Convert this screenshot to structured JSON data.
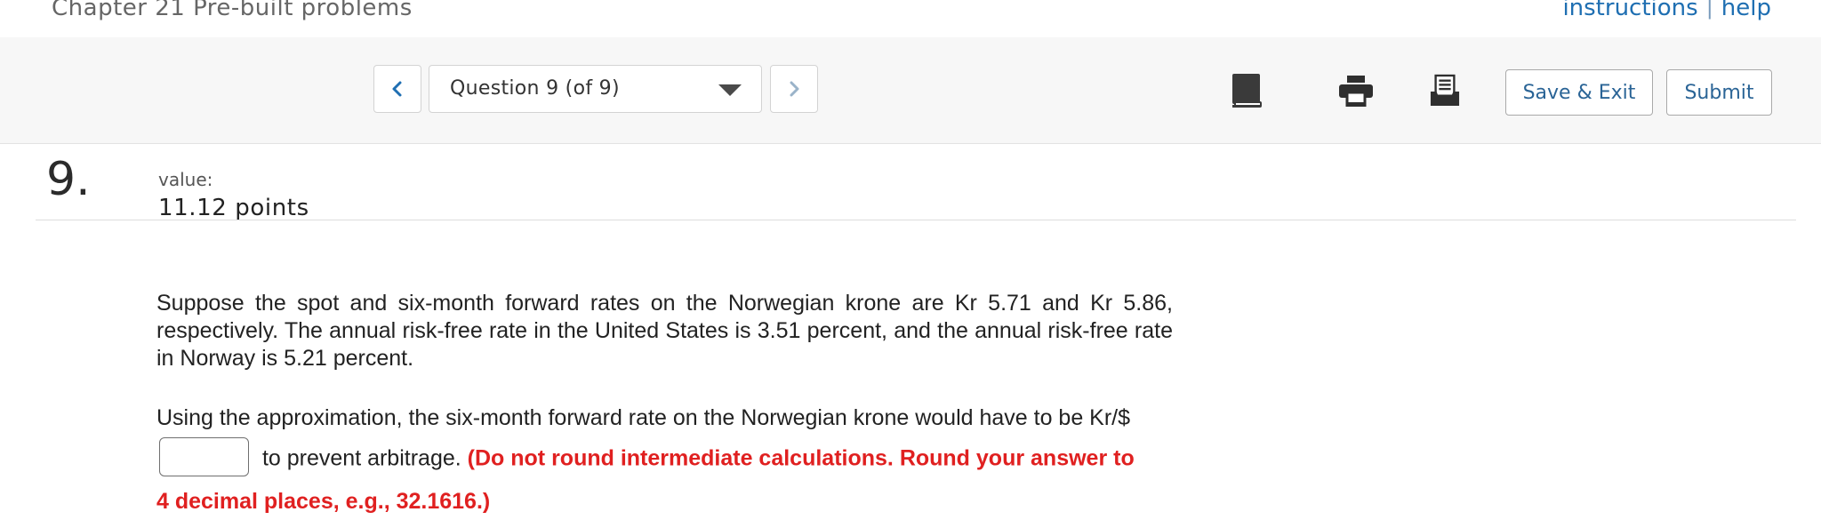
{
  "header": {
    "chapter_title": "Chapter 21 Pre-built problems",
    "instructions_link": "instructions",
    "help_link": "help",
    "link_separator": "|"
  },
  "toolbar": {
    "question_selector": "Question 9 (of 9)",
    "save_exit_label": "Save & Exit",
    "submit_label": "Submit",
    "icons": [
      "chevron-left-icon",
      "chevron-down-icon",
      "chevron-right-icon",
      "book-icon",
      "print-icon",
      "list-icon"
    ]
  },
  "question": {
    "number": "9.",
    "value_label": "value:",
    "value_points": "11.12 points",
    "paragraph1": "Suppose the spot and six-month forward rates on the Norwegian krone are Kr 5.71 and Kr 5.86, respectively. The annual risk-free rate in the United States is 3.51 percent, and the annual risk-free rate in Norway is 5.21 percent.",
    "paragraph2_line1": "Using the approximation, the six-month forward rate on the Norwegian krone would have to be Kr/$",
    "paragraph2_after_input": "to prevent arbitrage.",
    "instruction_red_part1": "(Do not round intermediate calculations. Round your answer to",
    "instruction_red_part2": "4 decimal places, e.g., 32.1616.)",
    "answer_value": ""
  },
  "colors": {
    "link_blue": "#1f6fb2",
    "button_text": "#2a6496",
    "instruction_red": "#e02020",
    "toolbar_bg": "#f7f7f7"
  }
}
